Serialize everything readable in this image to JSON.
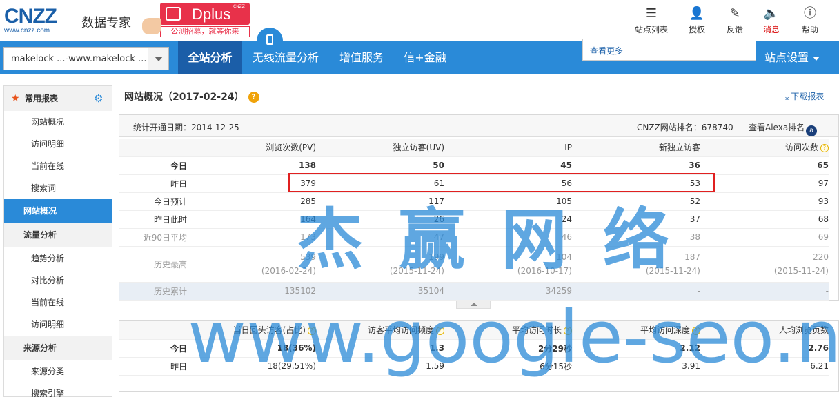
{
  "logo": {
    "main": "CNZZ",
    "sub": "www.cnzz.com",
    "title": "数据专家"
  },
  "dplus": {
    "name": "Dplus",
    "badge": "CNZZ",
    "tagline": "公测招募，就等你来"
  },
  "util": [
    {
      "label": "站点列表",
      "icon": "list-icon"
    },
    {
      "label": "授权",
      "icon": "user-icon"
    },
    {
      "label": "反馈",
      "icon": "edit-icon"
    },
    {
      "label": "消息",
      "icon": "speaker-icon"
    },
    {
      "label": "帮助",
      "icon": "help-icon"
    }
  ],
  "site_select": {
    "value": "makelock ...-www.makelock ..."
  },
  "tabs": [
    "全站分析",
    "无线流量分析",
    "增值服务",
    "信+金融"
  ],
  "dropdown_link": "查看更多",
  "site_settings": "站点设置",
  "sidebar": {
    "head1": "常用报表",
    "common": [
      "网站概况",
      "访问明细",
      "当前在线",
      "搜索词"
    ],
    "active": "网站概况",
    "head2": "流量分析",
    "traffic": [
      "趋势分析",
      "对比分析",
      "当前在线",
      "访问明细"
    ],
    "head3": "来源分析",
    "source": [
      "来源分类",
      "搜索引擎"
    ]
  },
  "page": {
    "title": "网站概况（2017-02-24）",
    "download": "下载报表"
  },
  "info": {
    "start": "统计开通日期：2014-12-25",
    "rank": "CNZZ网站排名：678740",
    "alexa": "查看Alexa排名"
  },
  "table1": {
    "headers": [
      "浏览次数(PV)",
      "独立访客(UV)",
      "IP",
      "新独立访客",
      "访问次数"
    ],
    "rows": [
      {
        "label": "今日",
        "values": [
          "138",
          "50",
          "45",
          "36",
          "65"
        ]
      },
      {
        "label": "昨日",
        "values": [
          "379",
          "61",
          "56",
          "53",
          "97"
        ]
      },
      {
        "label": "今日预计",
        "values": [
          "285",
          "117",
          "105",
          "52",
          "93"
        ]
      },
      {
        "label": "昨日此时",
        "values": [
          "164",
          "26",
          "24",
          "37",
          "68"
        ]
      },
      {
        "label": "近90日平均",
        "values": [
          "173",
          "47",
          "46",
          "38",
          "69"
        ]
      }
    ],
    "history_max": {
      "label": "历史最高",
      "values": [
        "539",
        "199",
        "104",
        "187",
        "220"
      ],
      "dates": [
        "(2016-02-24)",
        "(2015-11-24)",
        "(2016-10-17)",
        "(2015-11-24)",
        "(2015-11-24)"
      ]
    },
    "history_total": {
      "label": "历史累计",
      "values": [
        "135102",
        "35104",
        "34259",
        "-",
        "-"
      ]
    }
  },
  "table2": {
    "headers": [
      "当日回头访客(占比)",
      "访客平均访问频度",
      "平均访问时长",
      "平均访问深度",
      "人均浏览页数"
    ],
    "rows": [
      {
        "label": "今日",
        "values": [
          "18(36%)",
          "1.3",
          "2分29秒",
          "2.12",
          "2.76"
        ]
      },
      {
        "label": "昨日",
        "values": [
          "18(29.51%)",
          "1.59",
          "6分15秒",
          "3.91",
          "6.21"
        ]
      }
    ]
  },
  "watermark": {
    "line1": "杰赢网络",
    "line2": "www.google-seo.net"
  }
}
